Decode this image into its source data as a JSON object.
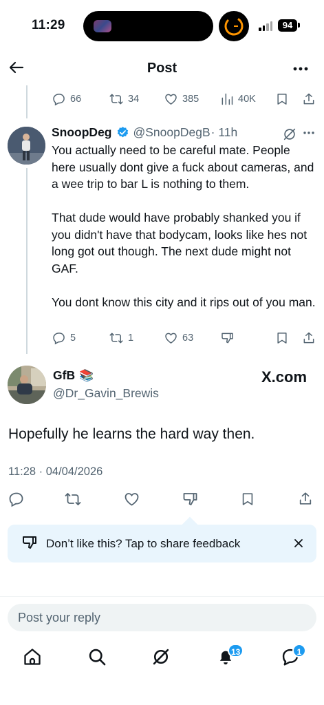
{
  "status_bar": {
    "time": "11:29",
    "battery": "94"
  },
  "header": {
    "title": "Post"
  },
  "parent_tweet_actions": {
    "replies": "66",
    "reposts": "34",
    "likes": "385",
    "views": "40K"
  },
  "reply_tweet": {
    "name": "SnoopDeg",
    "handle": "@SnoopDegB",
    "time": "· 11h",
    "text": "You actually need to be careful mate. People here usually dont give a fuck about cameras, and a wee trip to bar L is nothing to them.\n\nThat dude would have probably shanked you if you didn't have that bodycam, looks like hes not long got out though. The next dude might not GAF.\n\nYou dont know this city and it rips out of you man.",
    "replies": "5",
    "reposts": "1",
    "likes": "63"
  },
  "main_tweet": {
    "name": "GfB",
    "emoji": "📚",
    "handle": "@Dr_Gavin_Brewis",
    "source": "X.com",
    "text": "Hopefully he learns the hard way then.",
    "timestamp": "11:28 · 04/04/2026"
  },
  "feedback_banner": {
    "text": "Don’t like this? Tap to share feedback"
  },
  "reply_box": {
    "placeholder": "Post your reply"
  },
  "bottom_nav": {
    "notifications_badge": "13",
    "messages_badge": "1"
  },
  "colors": {
    "accent": "#1d9bf0",
    "secondary_text": "#536471",
    "banner_bg": "#e9f5fd"
  }
}
